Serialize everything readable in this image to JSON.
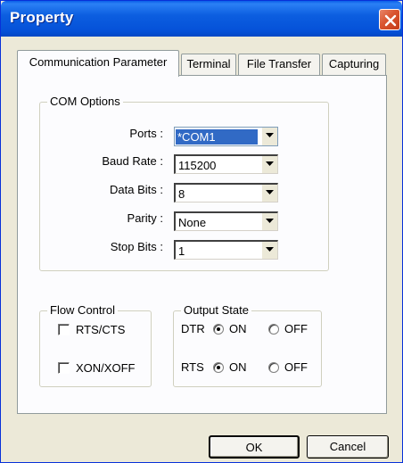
{
  "window": {
    "title": "Property"
  },
  "tabs": [
    {
      "label": "Communication Parameter",
      "active": true
    },
    {
      "label": "Terminal",
      "active": false
    },
    {
      "label": "File Transfer",
      "active": false
    },
    {
      "label": "Capturing",
      "active": false
    }
  ],
  "com_options": {
    "title": "COM Options",
    "fields": [
      {
        "label": "Ports :",
        "value": "*COM1"
      },
      {
        "label": "Baud Rate :",
        "value": "115200"
      },
      {
        "label": "Data Bits :",
        "value": "8"
      },
      {
        "label": "Parity :",
        "value": "None"
      },
      {
        "label": "Stop Bits :",
        "value": "1"
      }
    ]
  },
  "flow_control": {
    "title": "Flow Control",
    "rts_cts": {
      "label": "RTS/CTS",
      "checked": false
    },
    "xon_xoff": {
      "label": "XON/XOFF",
      "checked": false
    }
  },
  "output_state": {
    "title": "Output State",
    "dtr": {
      "label": "DTR",
      "on_label": "ON",
      "off_label": "OFF",
      "selected": "ON"
    },
    "rts": {
      "label": "RTS",
      "on_label": "ON",
      "off_label": "OFF",
      "selected": "ON"
    }
  },
  "buttons": {
    "ok": "OK",
    "cancel": "Cancel"
  },
  "colors": {
    "title_bar": "#0551d8",
    "close_button": "#d9542f",
    "selection": "#316ac5",
    "dialog_bg": "#ece9d8"
  }
}
